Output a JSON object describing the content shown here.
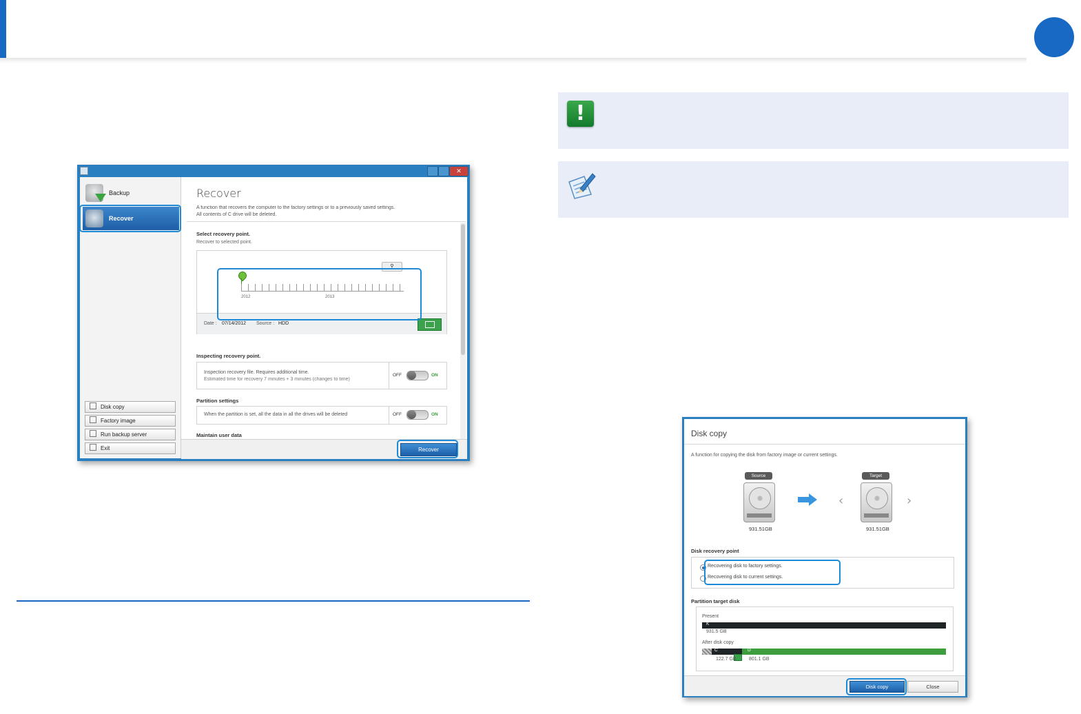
{
  "colors": {
    "accent": "#1769c4",
    "note_bg": "#e8edf8",
    "warning_icon": "#2b9a3c",
    "window_frame": "#2a7fc1",
    "highlight": "#1c8ad6"
  },
  "warning_icon": {
    "icon": "exclamation-icon",
    "glyph": "!"
  },
  "memo_icon": {
    "icon": "memo-pencil-icon"
  },
  "recover_window": {
    "sidebar": {
      "backup_label": "Backup",
      "recover_label": "Recover"
    },
    "tools": {
      "disk_copy": "Disk copy",
      "factory_image": "Factory image",
      "run_backup_server": "Run backup server",
      "exit": "Exit"
    },
    "title": "Recover",
    "desc_line1": "A function that recovers the computer to the factory settings or to a previously saved settings.",
    "desc_line2": "All contents of C drive will be deleted.",
    "section_recovery_point": "Select recovery point.",
    "section_recovery_point_sub": "Recover to selected point.",
    "timeline": {
      "year_start": "2012",
      "year_end": "2013",
      "date_label": "Date :",
      "date_value": "07/14/2012",
      "source_label": "Source :",
      "source_value": "HDD"
    },
    "section_inspecting": "Inspecting recovery point.",
    "inspect_line1": "Inspection recovery file. Requires additional time.",
    "inspect_line2": "Estimated time for recovery 7 minutes + 3 minutes (changes to time)",
    "toggle_off": "OFF",
    "toggle_on": "ON",
    "section_partition": "Partition settings",
    "partition_line": "When the partition is set, all the data in all the drives will be deleted",
    "section_maintain": "Maintain user data",
    "recover_button": "Recover"
  },
  "disk_copy_window": {
    "title": "Disk copy",
    "desc": "A function for copying the disk from factory image or current settings.",
    "source_tag": "Source",
    "target_tag": "Target",
    "source_size": "931.51GB",
    "target_size": "931.51GB",
    "section_recovery_point": "Disk recovery point",
    "radio_factory": "Recovering disk to factory settings.",
    "radio_current": "Recovering disk to current settings.",
    "section_partition": "Partition target disk",
    "present_label": "Present",
    "present_drive": "K",
    "present_size": "931.5 GB",
    "after_label": "After disk copy",
    "after_drive_c": "C",
    "after_drive_d": "D",
    "after_size_c": "122.7 GB",
    "after_size_d": "801.1 GB",
    "disk_copy_button": "Disk copy",
    "close_button": "Close"
  }
}
